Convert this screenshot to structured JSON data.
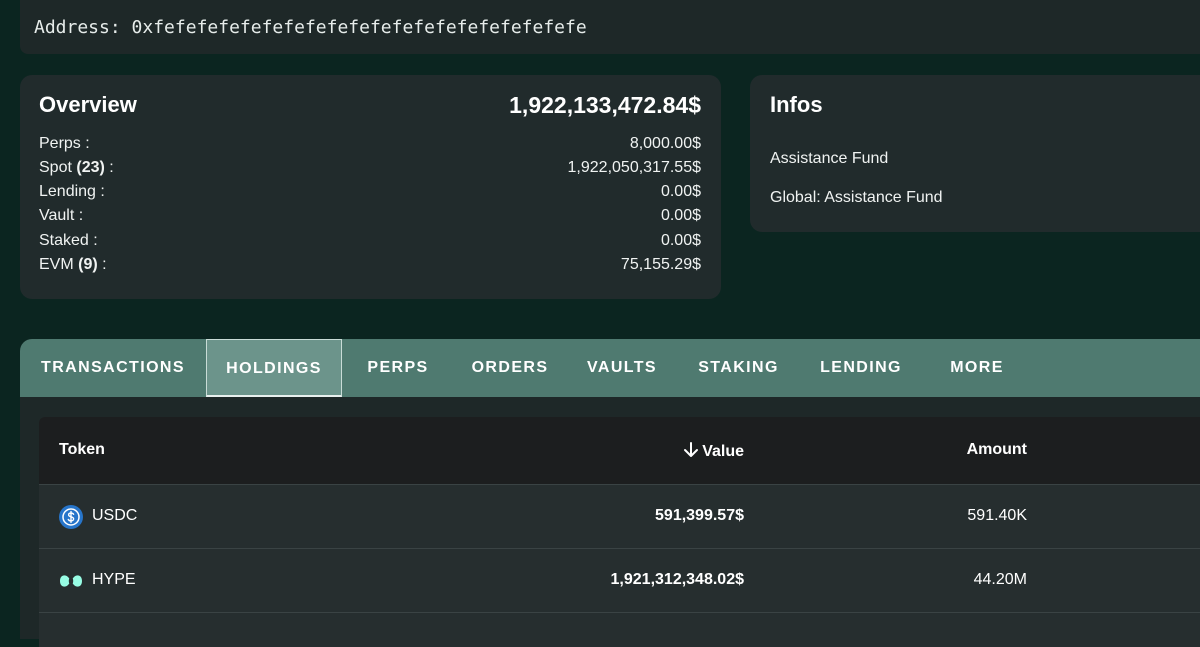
{
  "address": {
    "label": "Address:",
    "value": "0xfefefefefefefefefefefefefefefefefefefefe"
  },
  "overview": {
    "title": "Overview",
    "total": "1,922,133,472.84$",
    "rows": [
      {
        "label": "Perps :",
        "count": "",
        "suffix": "",
        "value": "8,000.00$"
      },
      {
        "label": "Spot ",
        "count": "(23)",
        "suffix": " :",
        "value": "1,922,050,317.55$"
      },
      {
        "label": "Lending :",
        "count": "",
        "suffix": "",
        "value": "0.00$"
      },
      {
        "label": "Vault :",
        "count": "",
        "suffix": "",
        "value": "0.00$"
      },
      {
        "label": "Staked :",
        "count": "",
        "suffix": "",
        "value": "0.00$"
      },
      {
        "label": "EVM ",
        "count": "(9)",
        "suffix": " :",
        "value": "75,155.29$"
      }
    ]
  },
  "infos": {
    "title": "Infos",
    "lines": [
      "Assistance Fund",
      "Global: Assistance Fund"
    ]
  },
  "tabs": [
    {
      "label": "TRANSACTIONS",
      "active": false
    },
    {
      "label": "HOLDINGS",
      "active": true
    },
    {
      "label": "PERPS",
      "active": false
    },
    {
      "label": "ORDERS",
      "active": false
    },
    {
      "label": "VAULTS",
      "active": false
    },
    {
      "label": "STAKING",
      "active": false
    },
    {
      "label": "LENDING",
      "active": false
    },
    {
      "label": "MORE",
      "active": false
    }
  ],
  "holdings": {
    "columns": {
      "token": "Token",
      "value": "Value",
      "amount": "Amount"
    },
    "sort_icon": "arrow-down-icon",
    "rows": [
      {
        "token": "USDC",
        "icon": "usdc-icon",
        "value": "591,399.57$",
        "amount": "591.40K"
      },
      {
        "token": "HYPE",
        "icon": "hype-icon",
        "value": "1,921,312,348.02$",
        "amount": "44.20M"
      }
    ]
  },
  "colors": {
    "background": "#0b2520",
    "card": "#212b2c",
    "tab_bar": "#4f7a70",
    "usdc_blue": "#2775ca",
    "hype_mint": "#97fce4"
  }
}
